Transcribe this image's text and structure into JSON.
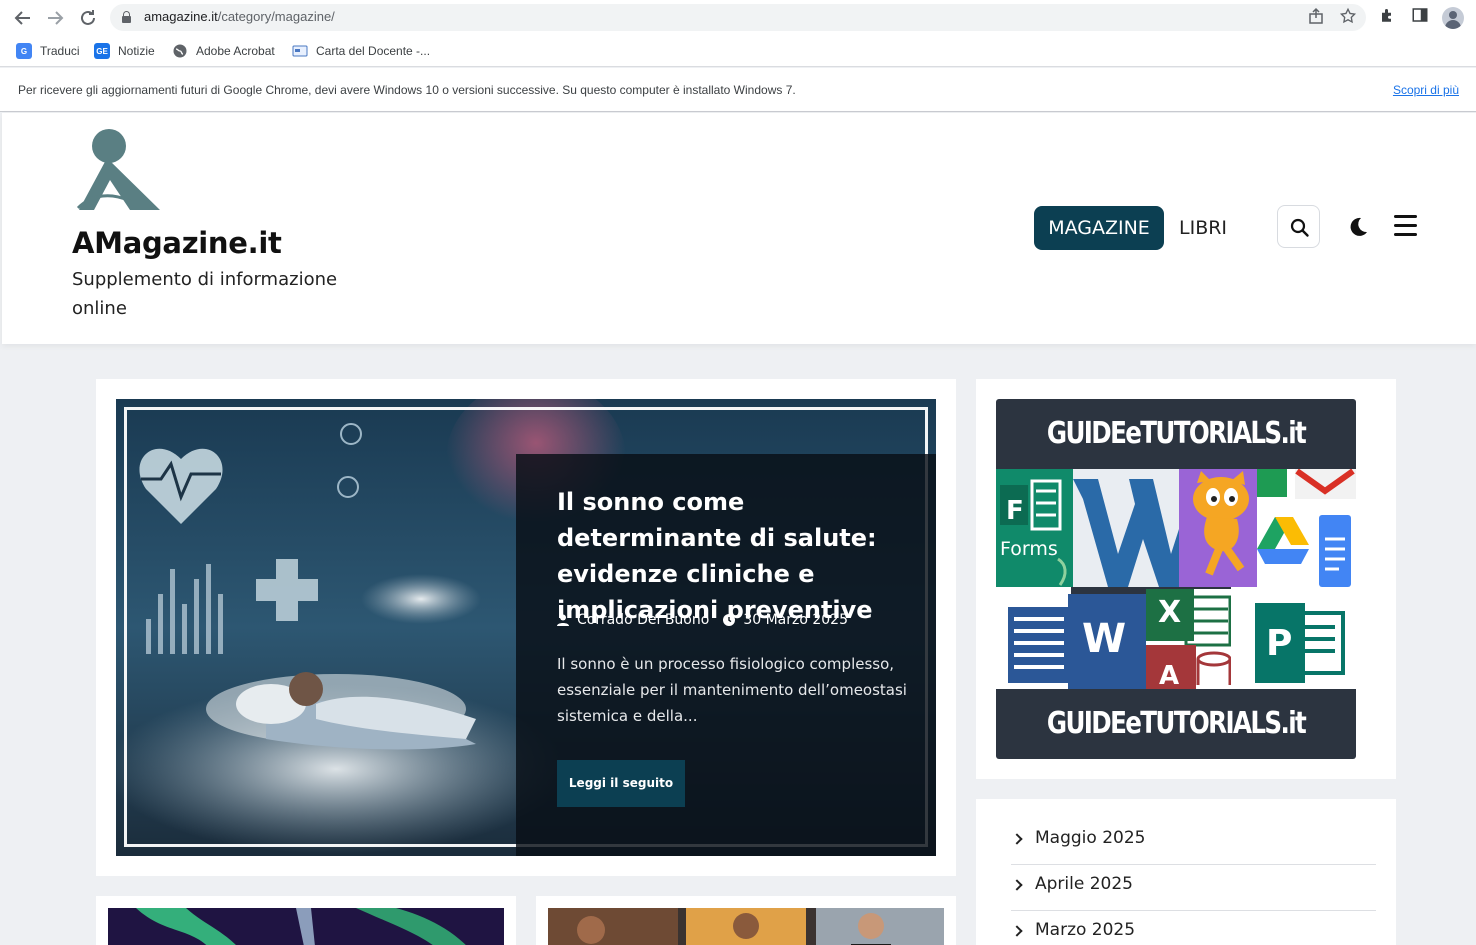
{
  "browser": {
    "url_host": "amagazine.it",
    "url_path": "/category/magazine/",
    "bookmarks": [
      {
        "label": "Traduci"
      },
      {
        "label": "Notizie"
      },
      {
        "label": "Adobe Acrobat"
      },
      {
        "label": "Carta del Docente -..."
      }
    ],
    "infobar": {
      "message": "Per ricevere gli aggiornamenti futuri di Google Chrome, devi avere Windows 10 o versioni successive. Su questo computer è installato Windows 7.",
      "link": "Scopri di più"
    }
  },
  "site": {
    "title": "AMagazine.it",
    "tagline": "Supplemento di informazione online",
    "nav": [
      {
        "label": "MAGAZINE",
        "active": true
      },
      {
        "label": "LIBRI",
        "active": false
      }
    ],
    "accent_color": "#0c3f52"
  },
  "featured_post": {
    "title": "Il sonno come determinante di salute: evidenze cliniche e implicazioni preventive",
    "author": "Corrado Del Buono",
    "date": "30 Marzo 2025",
    "excerpt": "Il sonno è un processo fisiologico complesso, essenziale per il mantenimento dell’omeostasi sistemica e della...",
    "read_more": "Leggi il seguito"
  },
  "sidebar": {
    "banner": {
      "title_top": "GUIDEeTUTORIALS.it",
      "title_bottom": "GUIDEeTUTORIALS.it",
      "forms_label": "Forms",
      "word_letter": "W",
      "excel_letter": "X",
      "access_letter": "A",
      "publisher_letter": "P"
    },
    "archive": [
      {
        "label": "Maggio 2025"
      },
      {
        "label": "Aprile 2025"
      },
      {
        "label": "Marzo 2025"
      }
    ]
  }
}
